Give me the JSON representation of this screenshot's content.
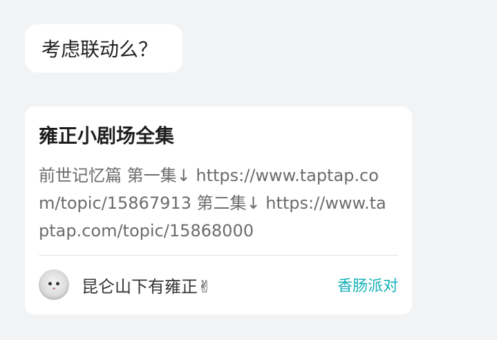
{
  "comment": {
    "text": "考虑联动么？"
  },
  "post_card": {
    "title": "雍正小剧场全集",
    "body": "前世记忆篇 第一集↓ https://www.taptap.com/topic/15867913 第二集↓ https://www.taptap.com/topic/15868000",
    "author": "昆仑山下有雍正✌",
    "group": "香肠派对",
    "accent_color": "#15b0b8"
  }
}
